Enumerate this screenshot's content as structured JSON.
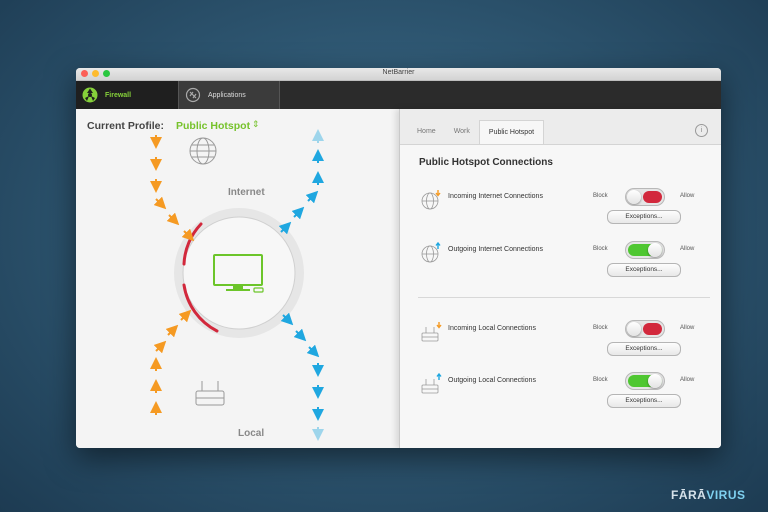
{
  "window": {
    "title": "NetBarrier"
  },
  "tabs": [
    {
      "label": "Firewall",
      "active": true,
      "icon": "firewall-icon"
    },
    {
      "label": "Applications",
      "active": false,
      "icon": "applications-icon"
    }
  ],
  "left": {
    "profile_label": "Current Profile:",
    "profile_value": "Public Hotspot",
    "internet_label": "Internet",
    "local_label": "Local"
  },
  "right": {
    "subtabs": [
      "Home",
      "Work",
      "Public Hotspot"
    ],
    "active_subtab": "Public Hotspot",
    "heading": "Public Hotspot Connections",
    "block_label": "Block",
    "allow_label": "Allow",
    "connections": [
      {
        "label": "Incoming Internet Connections",
        "state": "block",
        "exceptions": "Exceptions..."
      },
      {
        "label": "Outgoing Internet Connections",
        "state": "allow",
        "exceptions": "Exceptions..."
      },
      {
        "label": "Incoming Local Connections",
        "state": "block",
        "exceptions": "Exceptions..."
      },
      {
        "label": "Outgoing Local Connections",
        "state": "allow",
        "exceptions": "Exceptions..."
      }
    ]
  },
  "colors": {
    "accent_green": "#76c22b",
    "block_red": "#d2283c",
    "incoming_orange": "#f59a23",
    "outgoing_blue": "#1fa7e0"
  },
  "watermark": {
    "part1": "FĀRĀ",
    "part2": "VIRUS"
  }
}
